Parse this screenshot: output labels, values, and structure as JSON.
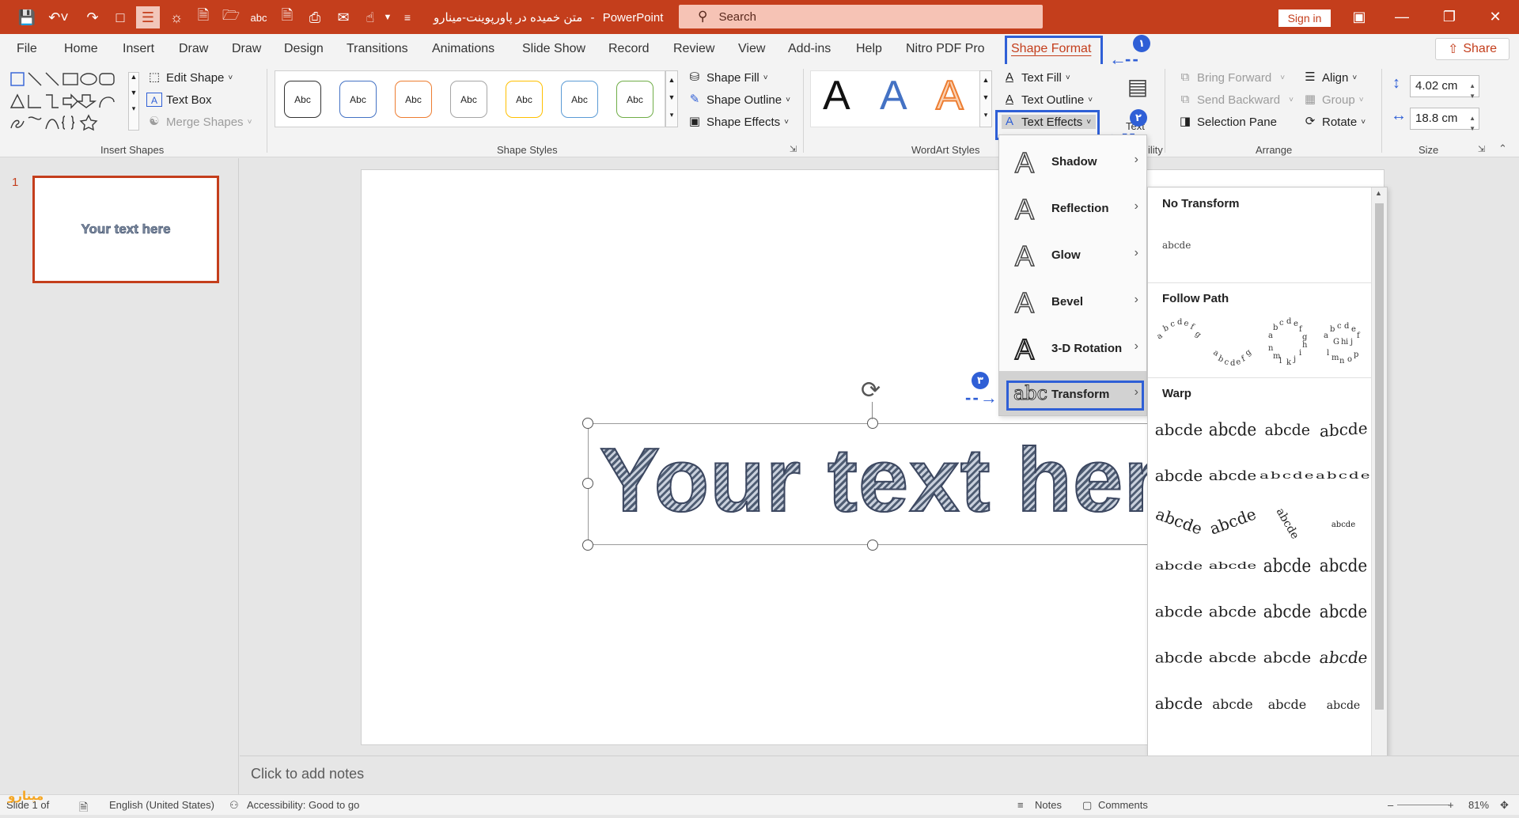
{
  "window": {
    "doc_title": "متن خمیده در پاورپوینت-مینارو",
    "app_name": "PowerPoint",
    "search_placeholder": "Search",
    "sign_in": "Sign in"
  },
  "tabs": [
    "File",
    "Home",
    "Insert",
    "Draw",
    "Draw",
    "Design",
    "Transitions",
    "Animations",
    "Slide Show",
    "Record",
    "Review",
    "View",
    "Add-ins",
    "Help",
    "Nitro PDF Pro",
    "Shape Format"
  ],
  "share_label": "Share",
  "ribbon": {
    "insert_shapes": {
      "edit_shape": "Edit Shape",
      "text_box": "Text Box",
      "merge_shapes": "Merge Shapes",
      "label": "Insert Shapes"
    },
    "shape_styles": {
      "preset_label": "Abc",
      "shape_fill": "Shape Fill",
      "shape_outline": "Shape Outline",
      "shape_effects": "Shape Effects",
      "label": "Shape Styles",
      "preset_colors": [
        "#333333",
        "#4472c4",
        "#ed7d31",
        "#a5a5a5",
        "#ffc000",
        "#5b9bd5",
        "#70ad47"
      ]
    },
    "wordart": {
      "letter": "A",
      "text_fill": "Text Fill",
      "text_outline": "Text Outline",
      "text_effects": "Text Effects",
      "label": "WordArt Styles"
    },
    "alt_text": "Text",
    "accessibility_tail": "ility",
    "arrange": {
      "bring_forward": "Bring Forward",
      "send_backward": "Send Backward",
      "selection_pane": "Selection Pane",
      "align": "Align",
      "group": "Group",
      "rotate": "Rotate",
      "label": "Arrange"
    },
    "size": {
      "height": "4.02 cm",
      "width": "18.8 cm",
      "label": "Size"
    }
  },
  "annotations": {
    "badge1": "١",
    "badge2": "٢",
    "badge3": "٣"
  },
  "slide_panel": {
    "number": "1",
    "thumb_text": "Your text here"
  },
  "slide": {
    "main_text": "Your text here"
  },
  "notes_placeholder": "Click to add notes",
  "text_effects_menu": [
    {
      "label": "Shadow",
      "icon": "A"
    },
    {
      "label": "Reflection",
      "icon": "A"
    },
    {
      "label": "Glow",
      "icon": "A"
    },
    {
      "label": "Bevel",
      "icon": "A"
    },
    {
      "label": "3-D Rotation",
      "icon": "A"
    },
    {
      "label": "Transform",
      "icon": "abc"
    }
  ],
  "transform_gallery": {
    "no_transform": "No Transform",
    "no_transform_sample": "abcde",
    "follow_path": "Follow Path",
    "warp": "Warp",
    "warp_sample": "abcde"
  },
  "statusbar": {
    "slide_info": "Slide 1 of",
    "language": "English (United States)",
    "accessibility": "Accessibility: Good to go",
    "notes": "Notes",
    "comments": "Comments",
    "zoom": "81%"
  },
  "watermark": "مینارو"
}
